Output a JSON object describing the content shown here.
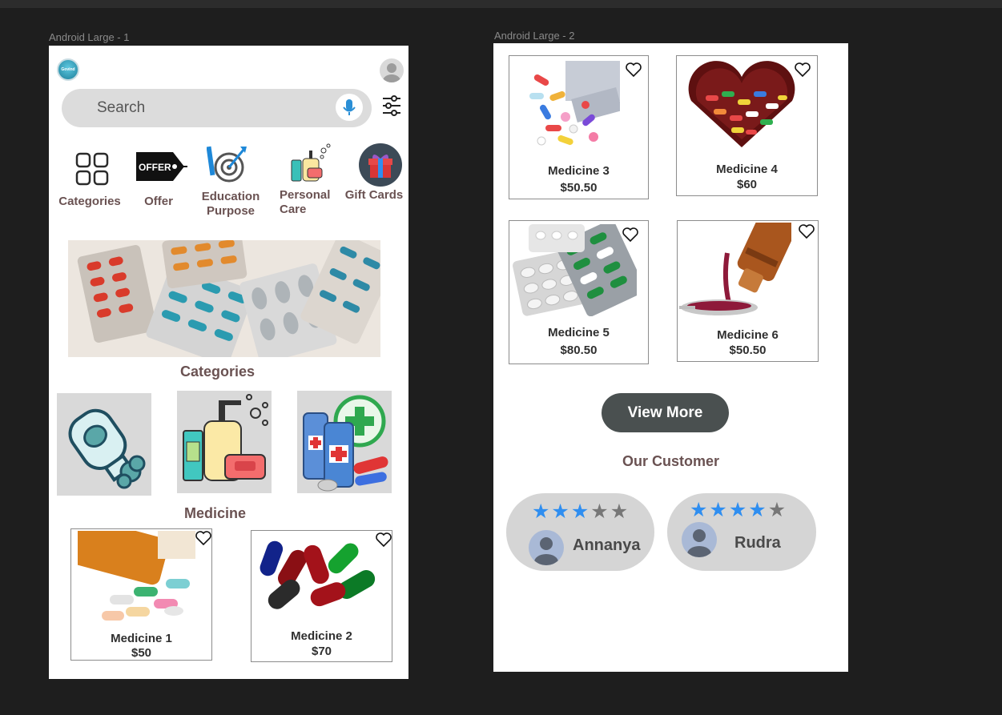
{
  "canvas": {
    "frame1_label": "Android Large - 1",
    "frame2_label": "Android Large - 2"
  },
  "header": {
    "logo_text": "Govind",
    "search_placeholder": "Search",
    "icons": [
      "logo-icon",
      "profile-avatar-icon",
      "microphone-icon",
      "filter-sliders-icon"
    ]
  },
  "quick_links": [
    {
      "label": "Categories",
      "icon": "grid-icon"
    },
    {
      "label": "Offer",
      "icon": "offer-tag-icon"
    },
    {
      "label": "Education\nPurpose",
      "icon": "education-target-icon"
    },
    {
      "label": "Personal\nCare",
      "icon": "personal-care-bottles-icon"
    },
    {
      "label": "Gift Cards",
      "icon": "gift-box-icon"
    }
  ],
  "offer_tag_text": "OFFER",
  "sections": {
    "categories_title": "Categories",
    "medicine_title": "Medicine",
    "our_customer_title": "Our Customer"
  },
  "category_tiles": [
    "inhaler-spray-icon",
    "soap-bottles-icon",
    "medicine-bottles-icon"
  ],
  "medicines": [
    {
      "name": "Medicine 1",
      "price": "$50"
    },
    {
      "name": "Medicine 2",
      "price": "$70"
    },
    {
      "name": "Medicine 3",
      "price": "$50.50"
    },
    {
      "name": "Medicine 4",
      "price": "$60"
    },
    {
      "name": "Medicine 5",
      "price": "$80.50"
    },
    {
      "name": "Medicine 6",
      "price": "$50.50"
    }
  ],
  "view_more_label": "View More",
  "reviews": [
    {
      "name": "Annanya",
      "stars_filled": 3,
      "stars_total": 5
    },
    {
      "name": "Rudra",
      "stars_filled": 4,
      "stars_total": 5
    }
  ],
  "colors": {
    "canvas_bg": "#1e1e1e",
    "accent_text": "#6a5252",
    "button_bg": "#4a5050",
    "star_on": "#2f8ef0",
    "star_off": "#777777",
    "search_bg": "#dcdcdc"
  }
}
